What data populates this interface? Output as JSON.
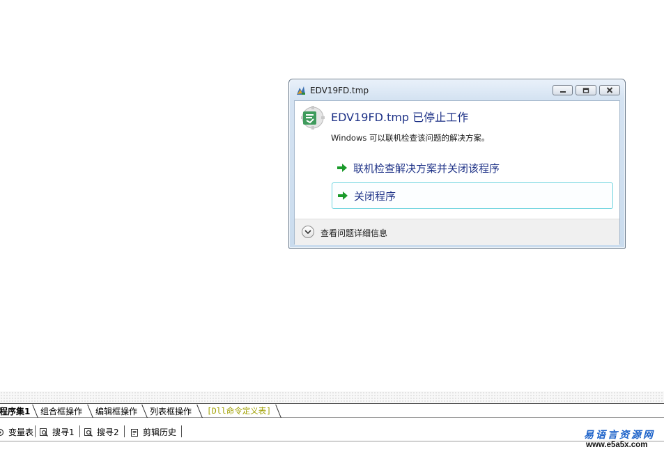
{
  "dialog": {
    "window_title": "EDV19FD.tmp",
    "heading": "EDV19FD.tmp 已停止工作",
    "message": "Windows 可以联机检查该问题的解决方案。",
    "options": [
      {
        "label": "联机检查解决方案并关闭该程序",
        "icon": "green-arrow-icon"
      },
      {
        "label": "关闭程序",
        "icon": "green-arrow-icon"
      }
    ],
    "footer_link": "查看问题详细信息",
    "controls": [
      "minimize",
      "maximize",
      "close"
    ]
  },
  "ide": {
    "tabs": [
      {
        "label": "程序集1",
        "active": true
      },
      {
        "label": "组合框操作"
      },
      {
        "label": "编辑框操作"
      },
      {
        "label": "列表框操作"
      },
      {
        "label": "[Dll命令定义表]"
      }
    ],
    "toolbar": [
      {
        "label": "变量表",
        "icon": "variable-table-icon"
      },
      {
        "label": "搜寻1",
        "icon": "search-icon"
      },
      {
        "label": "搜寻2",
        "icon": "search-icon"
      },
      {
        "label": "剪辑历史",
        "icon": "clipboard-icon"
      }
    ]
  },
  "watermark": {
    "brand": "易语言资源网",
    "url": "www.e5a5x.com"
  },
  "colors": {
    "accent_text": "#1e3287",
    "selected_border": "#6fd4df",
    "arrow_green": "#1a9a2a",
    "dll_tab_text": "#a0a000",
    "brand_blue": "#1c62c9"
  }
}
